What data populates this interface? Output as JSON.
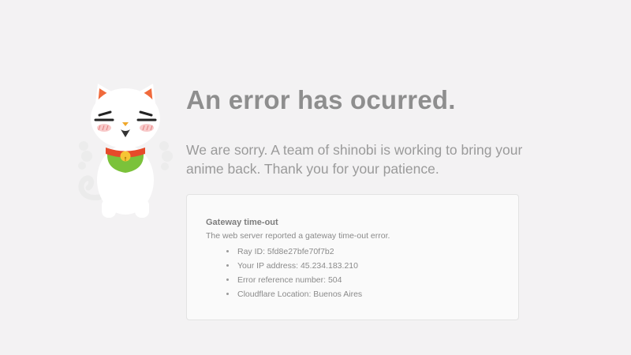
{
  "error_page": {
    "title": "An error has ocurred.",
    "message": "We are sorry. A team of shinobi is working to bring your anime back. Thank you for your patience.",
    "details_box": {
      "heading": "Gateway time-out",
      "description": "The web server reported a gateway time-out error.",
      "items": [
        "Ray ID: 5fd8e27bfe70f7b2",
        "Your IP address: 45.234.183.210",
        "Error reference number: 504",
        "Cloudflare Location: Buenos Aires"
      ]
    }
  },
  "colors": {
    "background": "#f3f2f3",
    "title": "#8e8e8e",
    "text": "#9a9a9a",
    "box_background": "#fafafa",
    "box_border": "#e3e3e3",
    "mascot_ear": "#f06a3c",
    "mascot_bib": "#7bc23a",
    "mascot_collar": "#e64a2a",
    "mascot_bell": "#f7c535"
  },
  "icons": {
    "mascot": "lucky-cat-mascot-icon"
  }
}
